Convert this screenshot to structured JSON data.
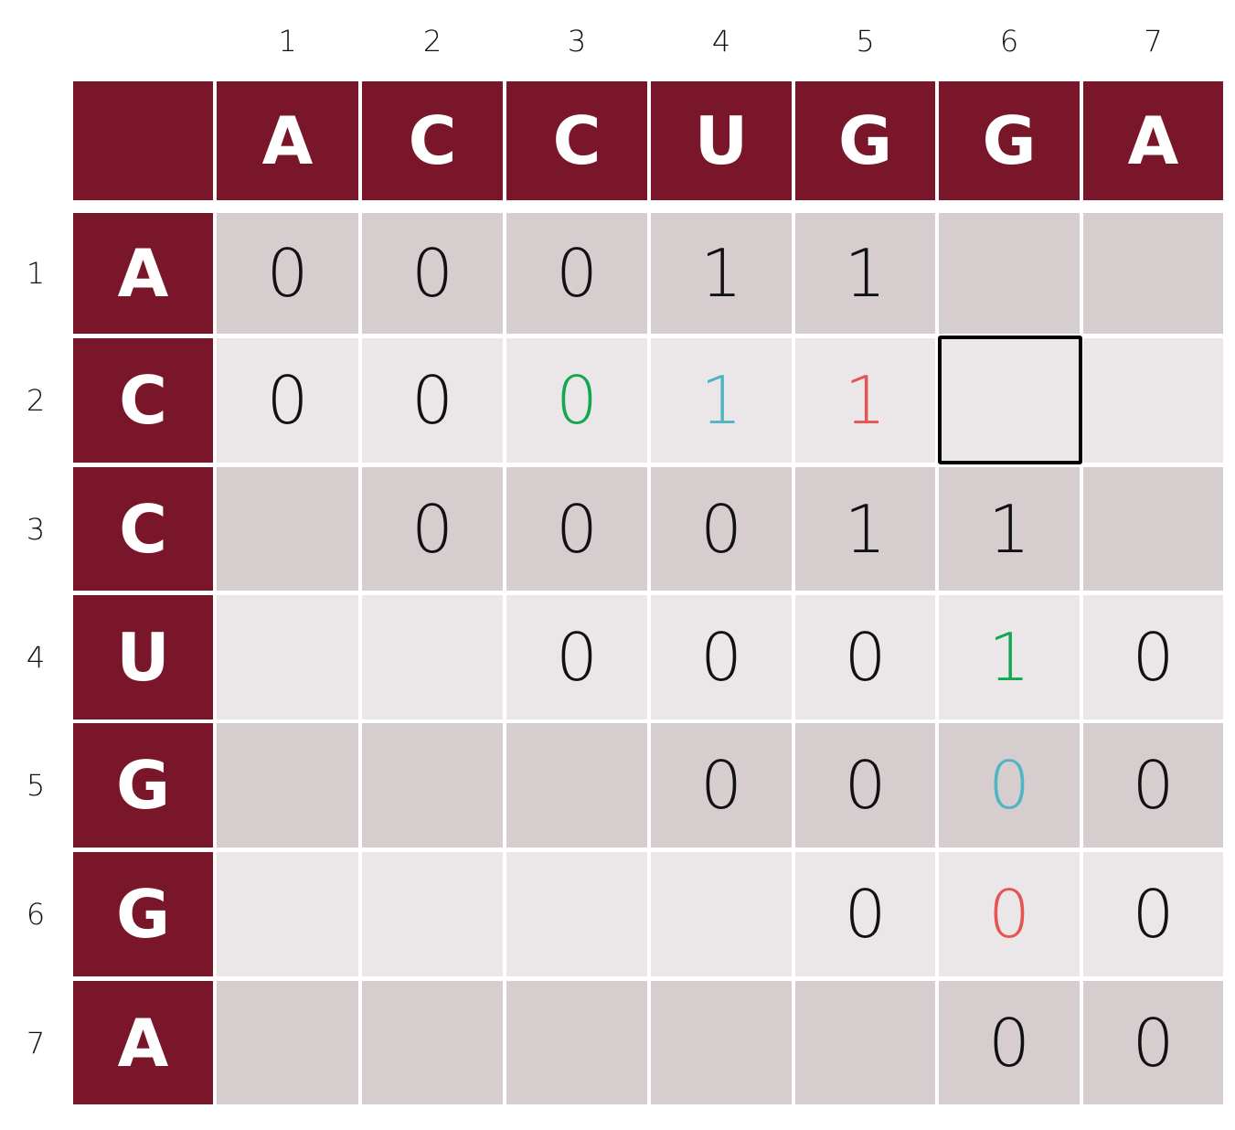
{
  "column_indices": [
    "1",
    "2",
    "3",
    "4",
    "5",
    "6",
    "7"
  ],
  "row_indices": [
    "1",
    "2",
    "3",
    "4",
    "5",
    "6",
    "7"
  ],
  "column_sequence": [
    "A",
    "C",
    "C",
    "U",
    "G",
    "G",
    "A"
  ],
  "row_sequence": [
    "A",
    "C",
    "C",
    "U",
    "G",
    "G",
    "A"
  ],
  "colors": {
    "header_bg": "#7a1629",
    "row_shade_dark": "#d6cdce",
    "row_shade_light": "#ebe7e8",
    "text_default": "#111111",
    "text_green": "#12a84f",
    "text_teal": "#4fb5c2",
    "text_red": "#e65454"
  },
  "matrix": [
    [
      {
        "v": "0"
      },
      {
        "v": "0"
      },
      {
        "v": "0"
      },
      {
        "v": "1"
      },
      {
        "v": "1"
      },
      {
        "v": ""
      },
      {
        "v": ""
      }
    ],
    [
      {
        "v": "0"
      },
      {
        "v": "0"
      },
      {
        "v": "0",
        "color": "green"
      },
      {
        "v": "1",
        "color": "teal"
      },
      {
        "v": "1",
        "color": "red"
      },
      {
        "v": "",
        "highlighted": true
      },
      {
        "v": ""
      }
    ],
    [
      {
        "v": ""
      },
      {
        "v": "0"
      },
      {
        "v": "0"
      },
      {
        "v": "0"
      },
      {
        "v": "1"
      },
      {
        "v": "1"
      },
      {
        "v": ""
      }
    ],
    [
      {
        "v": ""
      },
      {
        "v": ""
      },
      {
        "v": "0"
      },
      {
        "v": "0"
      },
      {
        "v": "0"
      },
      {
        "v": "1",
        "color": "green"
      },
      {
        "v": "0"
      }
    ],
    [
      {
        "v": ""
      },
      {
        "v": ""
      },
      {
        "v": ""
      },
      {
        "v": "0"
      },
      {
        "v": "0"
      },
      {
        "v": "0",
        "color": "teal"
      },
      {
        "v": "0"
      }
    ],
    [
      {
        "v": ""
      },
      {
        "v": ""
      },
      {
        "v": ""
      },
      {
        "v": ""
      },
      {
        "v": "0"
      },
      {
        "v": "0",
        "color": "red"
      },
      {
        "v": "0"
      }
    ],
    [
      {
        "v": ""
      },
      {
        "v": ""
      },
      {
        "v": ""
      },
      {
        "v": ""
      },
      {
        "v": ""
      },
      {
        "v": "0"
      },
      {
        "v": "0"
      }
    ]
  ]
}
